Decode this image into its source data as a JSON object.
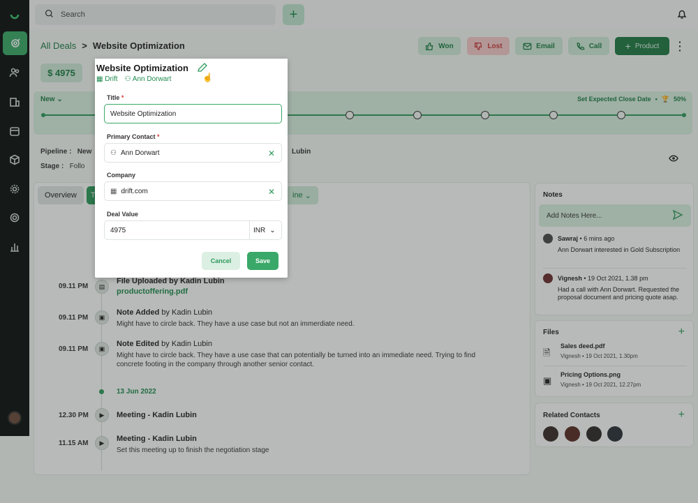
{
  "search": {
    "placeholder": "Search"
  },
  "breadcrumb": {
    "parent": "All Deals",
    "separator": ">",
    "current": "Website Optimization"
  },
  "actions": {
    "won": "Won",
    "lost": "Lost",
    "email": "Email",
    "call": "Call",
    "product": "Product"
  },
  "deal": {
    "value_display": "$ 4975"
  },
  "pipeline": {
    "stage_label": "New",
    "close_date": "Set Expected Close Date",
    "probability": "50%"
  },
  "meta": {
    "pipeline_label": "Pipeline :",
    "pipeline_value": "New",
    "stage_label": "Stage :",
    "stage_value": "Follo",
    "owner_partial": "Lubin"
  },
  "tabs": {
    "overview": "Overview",
    "t_partial": "T",
    "timeline_partial": "ine"
  },
  "timeline": [
    {
      "time": "09.11 PM",
      "title": "File Uploaded by Kadin Lubin",
      "text": "productoffering.pdf"
    },
    {
      "time": "09.11 PM",
      "title_bold": "Note Added",
      "title_rest": " by Kadin Lubin",
      "text": "Might have to circle back. They have a use case but not an immerdiate need."
    },
    {
      "time": "09.11 PM",
      "title_bold": "Note Edited",
      "title_rest": " by Kadin Lubin",
      "text": "Might have to circle back. They have a use case that can potentially be turned into an immediate need. Trying to find concrete footing in the company through another senior contact."
    },
    {
      "date": "13 Jun 2022"
    },
    {
      "time": "12.30 PM",
      "title": "Meeting - Kadin Lubin"
    },
    {
      "time": "11.15 AM",
      "title": "Meeting - Kadin Lubin",
      "text": "Set this meeting up to finish the negotiation stage"
    }
  ],
  "notes": {
    "title": "Notes",
    "placeholder": "Add Notes Here...",
    "items": [
      {
        "author": "Sawraj",
        "when": "6 mins ago",
        "text": "Ann Dorwart interested in Gold Subscription"
      },
      {
        "author": "Vignesh",
        "when": "19 Oct 2021, 1.38 pm",
        "text": "Had a call with Ann Dorwart. Requested the proposal document and pricing quote asap."
      }
    ]
  },
  "files": {
    "title": "Files",
    "items": [
      {
        "name": "Sales deed.pdf",
        "meta": "Vignesh • 19 Oct 2021, 1.30pm"
      },
      {
        "name": "Pricing Options.png",
        "meta": "Vignesh • 19 Oct 2021, 12.27pm"
      }
    ]
  },
  "related": {
    "title": "Related Contacts"
  },
  "modal": {
    "title": "Website Optimization",
    "company_tag": "Drift",
    "contact_tag": "Ann Dorwart",
    "title_label": "Title",
    "title_value": "Website Optimization",
    "contact_label": "Primary Contact",
    "contact_value": "Ann Dorwart",
    "company_label": "Company",
    "company_value": "drift.com",
    "deal_value_label": "Deal Value",
    "deal_value": "4975",
    "currency": "INR",
    "cancel": "Cancel",
    "save": "Save"
  },
  "colors": {
    "accent": "#2e9a5c",
    "sidebar": "#0d1110"
  }
}
